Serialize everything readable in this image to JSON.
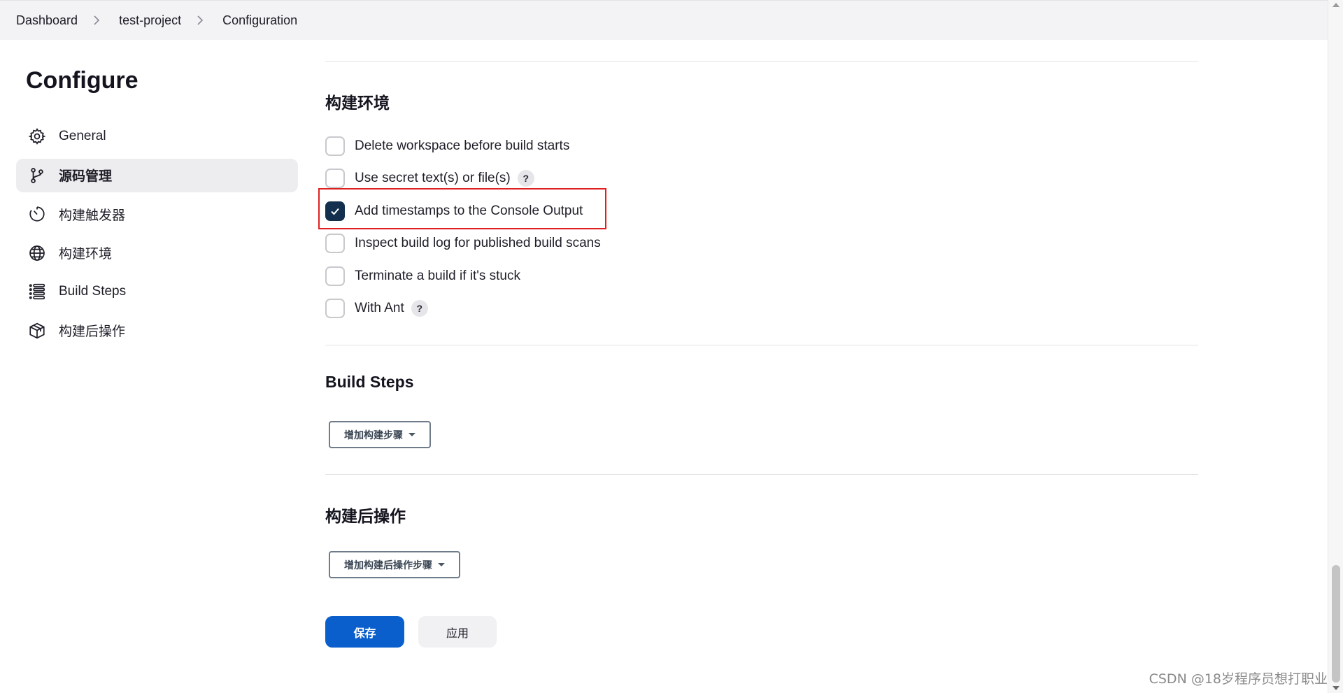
{
  "breadcrumb": {
    "items": [
      "Dashboard",
      "test-project",
      "Configuration"
    ]
  },
  "sidebar": {
    "title": "Configure",
    "items": [
      {
        "label": "General",
        "icon": "gear-icon",
        "active": false
      },
      {
        "label": "源码管理",
        "icon": "branch-icon",
        "active": true
      },
      {
        "label": "构建触发器",
        "icon": "timer-icon",
        "active": false
      },
      {
        "label": "构建环境",
        "icon": "globe-icon",
        "active": false
      },
      {
        "label": "Build Steps",
        "icon": "list-icon",
        "active": false
      },
      {
        "label": "构建后操作",
        "icon": "package-icon",
        "active": false
      }
    ]
  },
  "build_env": {
    "title": "构建环境",
    "options": [
      {
        "label": "Delete workspace before build starts",
        "checked": false,
        "help": false
      },
      {
        "label": "Use secret text(s) or file(s)",
        "checked": false,
        "help": true
      },
      {
        "label": "Add timestamps to the Console Output",
        "checked": true,
        "help": false
      },
      {
        "label": "Inspect build log for published build scans",
        "checked": false,
        "help": false
      },
      {
        "label": "Terminate a build if it's stuck",
        "checked": false,
        "help": false
      },
      {
        "label": "With Ant",
        "checked": false,
        "help": true
      }
    ],
    "help_glyph": "?"
  },
  "build_steps": {
    "title": "Build Steps",
    "add_button": "增加构建步骤"
  },
  "post_build": {
    "title": "构建后操作",
    "add_button": "增加构建后操作步骤"
  },
  "actions": {
    "save": "保存",
    "apply": "应用"
  },
  "watermark": "CSDN @18岁程序员想打职业",
  "colors": {
    "primary": "#0b5fcc",
    "checked": "#12304e",
    "highlight": "#e02020"
  }
}
